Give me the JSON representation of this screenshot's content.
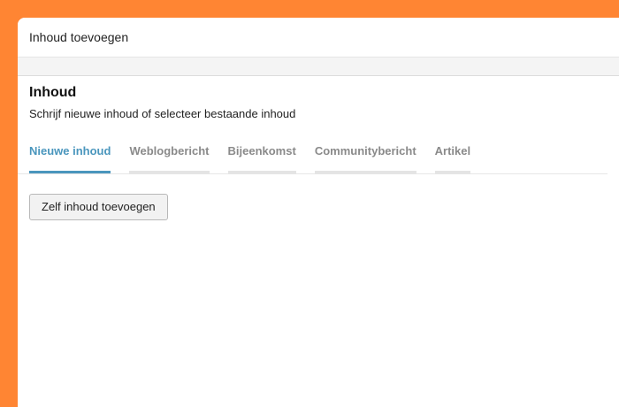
{
  "dialog": {
    "title": "Inhoud toevoegen"
  },
  "section": {
    "title": "Inhoud",
    "subtitle": "Schrijf nieuwe inhoud of selecteer bestaande inhoud"
  },
  "tabs": [
    {
      "label": "Nieuwe inhoud",
      "active": true
    },
    {
      "label": "Weblogbericht",
      "active": false
    },
    {
      "label": "Bijeenkomst",
      "active": false
    },
    {
      "label": "Communitybericht",
      "active": false
    },
    {
      "label": "Artikel",
      "active": false
    }
  ],
  "actions": {
    "add_self_label": "Zelf inhoud toevoegen"
  },
  "colors": {
    "background": "#ff8533",
    "accent": "#4a96bd"
  }
}
